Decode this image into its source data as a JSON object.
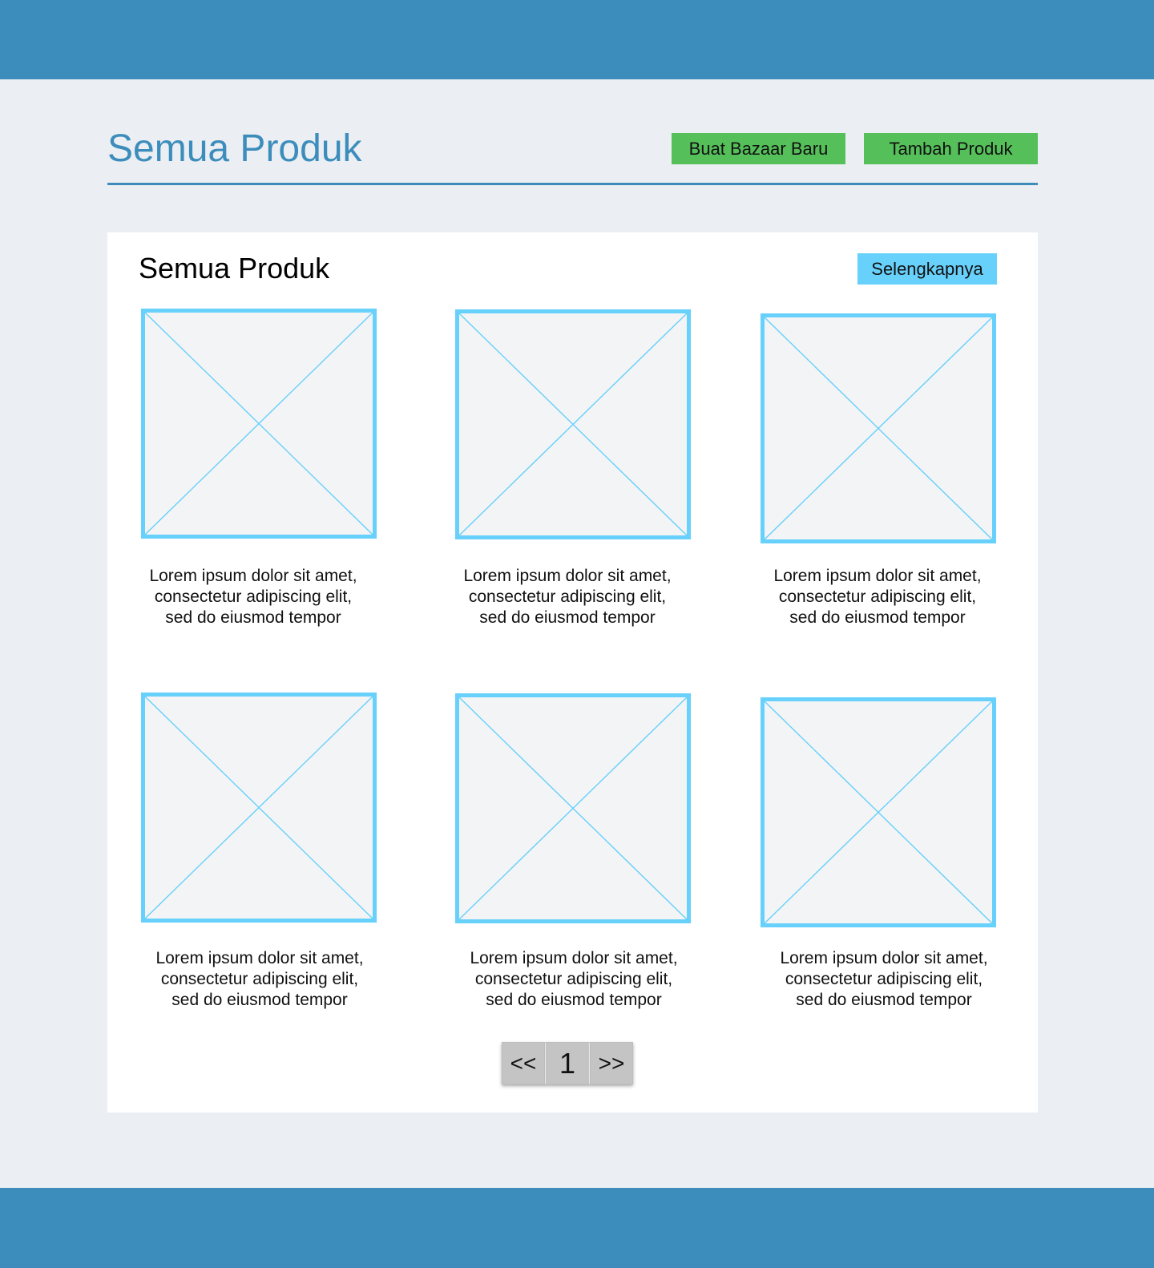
{
  "header": {
    "title": "Semua Produk"
  },
  "actions": {
    "new_bazaar_label": "Buat Bazaar Baru",
    "add_product_label": "Tambah Produk"
  },
  "panel": {
    "title": "Semua Produk",
    "more_label": "Selengkapnya"
  },
  "products": [
    {
      "line1": "Lorem ipsum dolor sit amet,",
      "line2": "consectetur adipiscing elit,",
      "line3": "sed do eiusmod tempor"
    },
    {
      "line1": "Lorem ipsum dolor sit amet,",
      "line2": "consectetur adipiscing elit,",
      "line3": "sed do eiusmod tempor"
    },
    {
      "line1": "Lorem ipsum dolor sit amet,",
      "line2": "consectetur adipiscing elit,",
      "line3": "sed do eiusmod tempor"
    },
    {
      "line1": "Lorem ipsum dolor sit amet,",
      "line2": "consectetur adipiscing elit,",
      "line3": "sed do eiusmod tempor"
    },
    {
      "line1": "Lorem ipsum dolor sit amet,",
      "line2": "consectetur adipiscing elit,",
      "line3": "sed do eiusmod tempor"
    },
    {
      "line1": "Lorem ipsum dolor sit amet,",
      "line2": "consectetur adipiscing elit,",
      "line3": "sed do eiusmod tempor"
    }
  ],
  "pagination": {
    "prev_label": "<<",
    "current_page": "1",
    "next_label": ">>"
  },
  "colors": {
    "brand": "#3d8dbc",
    "action_green": "#55c05a",
    "accent_cyan": "#67d0fb",
    "background": "#ebeff3"
  }
}
